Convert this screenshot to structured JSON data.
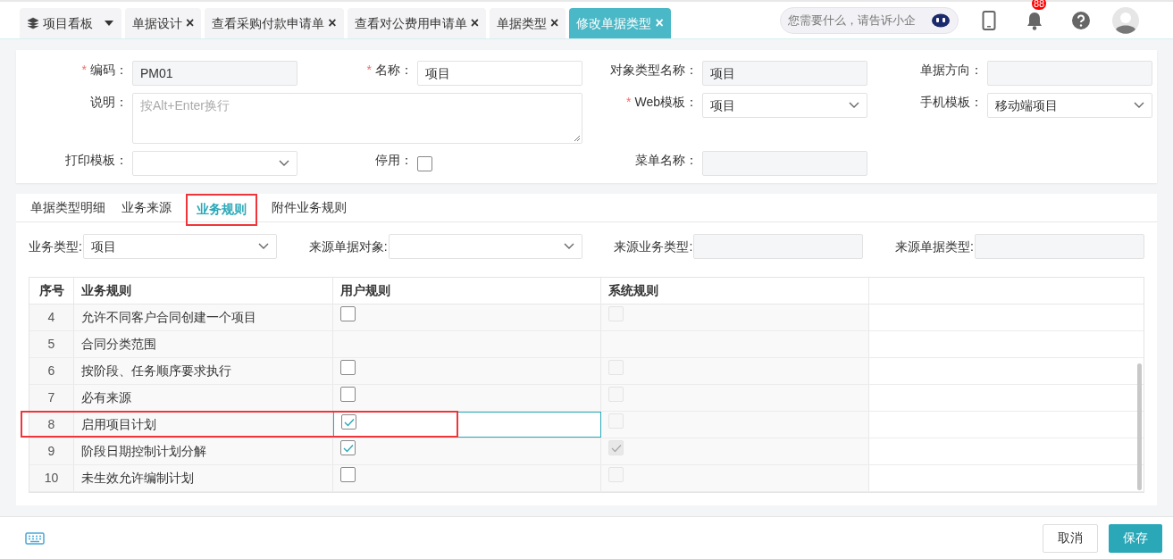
{
  "top_tabs": [
    {
      "label": "项目看板",
      "kind": "menu",
      "selected": false
    },
    {
      "label": "单据设计",
      "kind": "closable",
      "selected": false
    },
    {
      "label": "查看采购付款申请单",
      "kind": "closable",
      "selected": false
    },
    {
      "label": "查看对公费用申请单",
      "kind": "closable",
      "selected": false
    },
    {
      "label": "单据类型",
      "kind": "closable",
      "selected": false
    },
    {
      "label": "修改单据类型",
      "kind": "closable",
      "selected": true
    }
  ],
  "close_glyph": "×",
  "required_glyph": "*",
  "assistant": {
    "placeholder": "您需要什么，请告诉小企"
  },
  "notifications": {
    "count": "88"
  },
  "form": {
    "fields": [
      {
        "label": "编码：",
        "required": true,
        "kind": "readonly",
        "value": "PM01"
      },
      {
        "label": "名称：",
        "required": true,
        "kind": "text",
        "value": "项目"
      },
      {
        "label": "对象类型名称：",
        "required": false,
        "kind": "readonly",
        "value": "项目"
      },
      {
        "label": "单据方向：",
        "required": false,
        "kind": "readonly"
      },
      {
        "label": "说明：",
        "required": false,
        "kind": "textarea",
        "placeholder": "按Alt+Enter换行"
      },
      {
        "label": "Web模板：",
        "required": true,
        "kind": "select",
        "value": "项目"
      },
      {
        "label": "手机模板：",
        "required": false,
        "kind": "select",
        "value": "移动端项目"
      },
      {
        "label": "打印模板：",
        "required": false,
        "kind": "select"
      },
      {
        "label": "停用：",
        "required": false,
        "kind": "checkbox",
        "checked": false
      },
      {
        "label": "菜单名称：",
        "required": false,
        "kind": "readonly"
      }
    ]
  },
  "sub_tabs": [
    {
      "label": "单据类型明细",
      "selected": false,
      "marked": false
    },
    {
      "label": "业务来源",
      "selected": false,
      "marked": false
    },
    {
      "label": "业务规则",
      "selected": true,
      "marked": true
    },
    {
      "label": "附件业务规则",
      "selected": false,
      "marked": false
    }
  ],
  "filters": [
    {
      "label": "业务类型:",
      "kind": "select",
      "value": "项目"
    },
    {
      "label": "来源单据对象:",
      "kind": "select"
    },
    {
      "label": "来源业务类型:",
      "kind": "readonly"
    },
    {
      "label": "来源单据类型:",
      "kind": "readonly"
    }
  ],
  "table": {
    "columns": [
      "序号",
      "业务规则",
      "用户规则",
      "系统规则"
    ],
    "rows": [
      {
        "no": "4",
        "rule": "允许不同客户合同创建一个项目",
        "has_checkboxes": true,
        "user_checked": false,
        "system_checked": false,
        "selected": false,
        "marked": false
      },
      {
        "no": "5",
        "rule": "合同分类范围",
        "has_checkboxes": false,
        "selected": false,
        "marked": false
      },
      {
        "no": "6",
        "rule": "按阶段、任务顺序要求执行",
        "has_checkboxes": true,
        "user_checked": false,
        "system_checked": false,
        "selected": false,
        "marked": false
      },
      {
        "no": "7",
        "rule": "必有来源",
        "has_checkboxes": true,
        "user_checked": false,
        "system_checked": false,
        "selected": false,
        "marked": false
      },
      {
        "no": "8",
        "rule": "启用项目计划",
        "has_checkboxes": true,
        "user_checked": true,
        "system_checked": false,
        "selected": true,
        "marked": true
      },
      {
        "no": "9",
        "rule": "阶段日期控制计划分解",
        "has_checkboxes": true,
        "user_checked": true,
        "system_checked": true,
        "selected": false,
        "marked": false
      },
      {
        "no": "10",
        "rule": "未生效允许编制计划",
        "has_checkboxes": true,
        "user_checked": false,
        "system_checked": false,
        "selected": false,
        "marked": false
      }
    ]
  },
  "buttons": [
    {
      "label": "取消",
      "kind": "secondary"
    },
    {
      "label": "保存",
      "kind": "primary"
    }
  ]
}
